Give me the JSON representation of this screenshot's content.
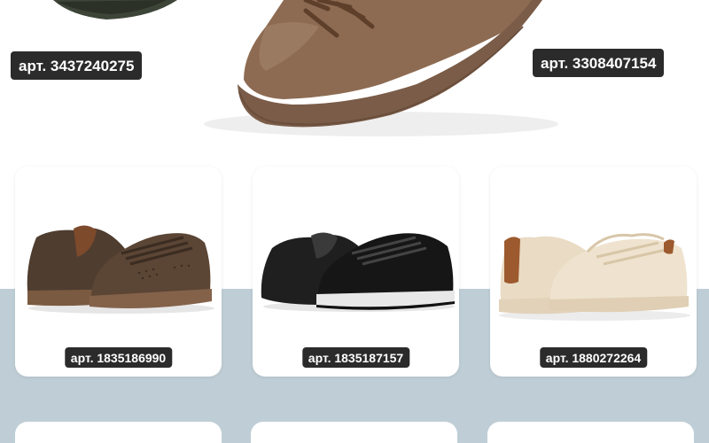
{
  "hero": {
    "sku_left": "арт. 3437240275",
    "sku_right": "арт. 3308407154"
  },
  "products": [
    {
      "sku": "арт. 1835186990",
      "icon": "brown-perforated-sneaker-icon",
      "color": "#5a4636"
    },
    {
      "sku": "арт. 1835187157",
      "icon": "black-leather-sneaker-icon",
      "color": "#1e1e1e"
    },
    {
      "sku": "арт. 1880272264",
      "icon": "beige-knit-sneaker-icon",
      "color": "#e9dcc4"
    }
  ],
  "colors": {
    "band": "#bfced6",
    "tag_bg": "#2b2b2b",
    "tag_text": "#ffffff"
  }
}
